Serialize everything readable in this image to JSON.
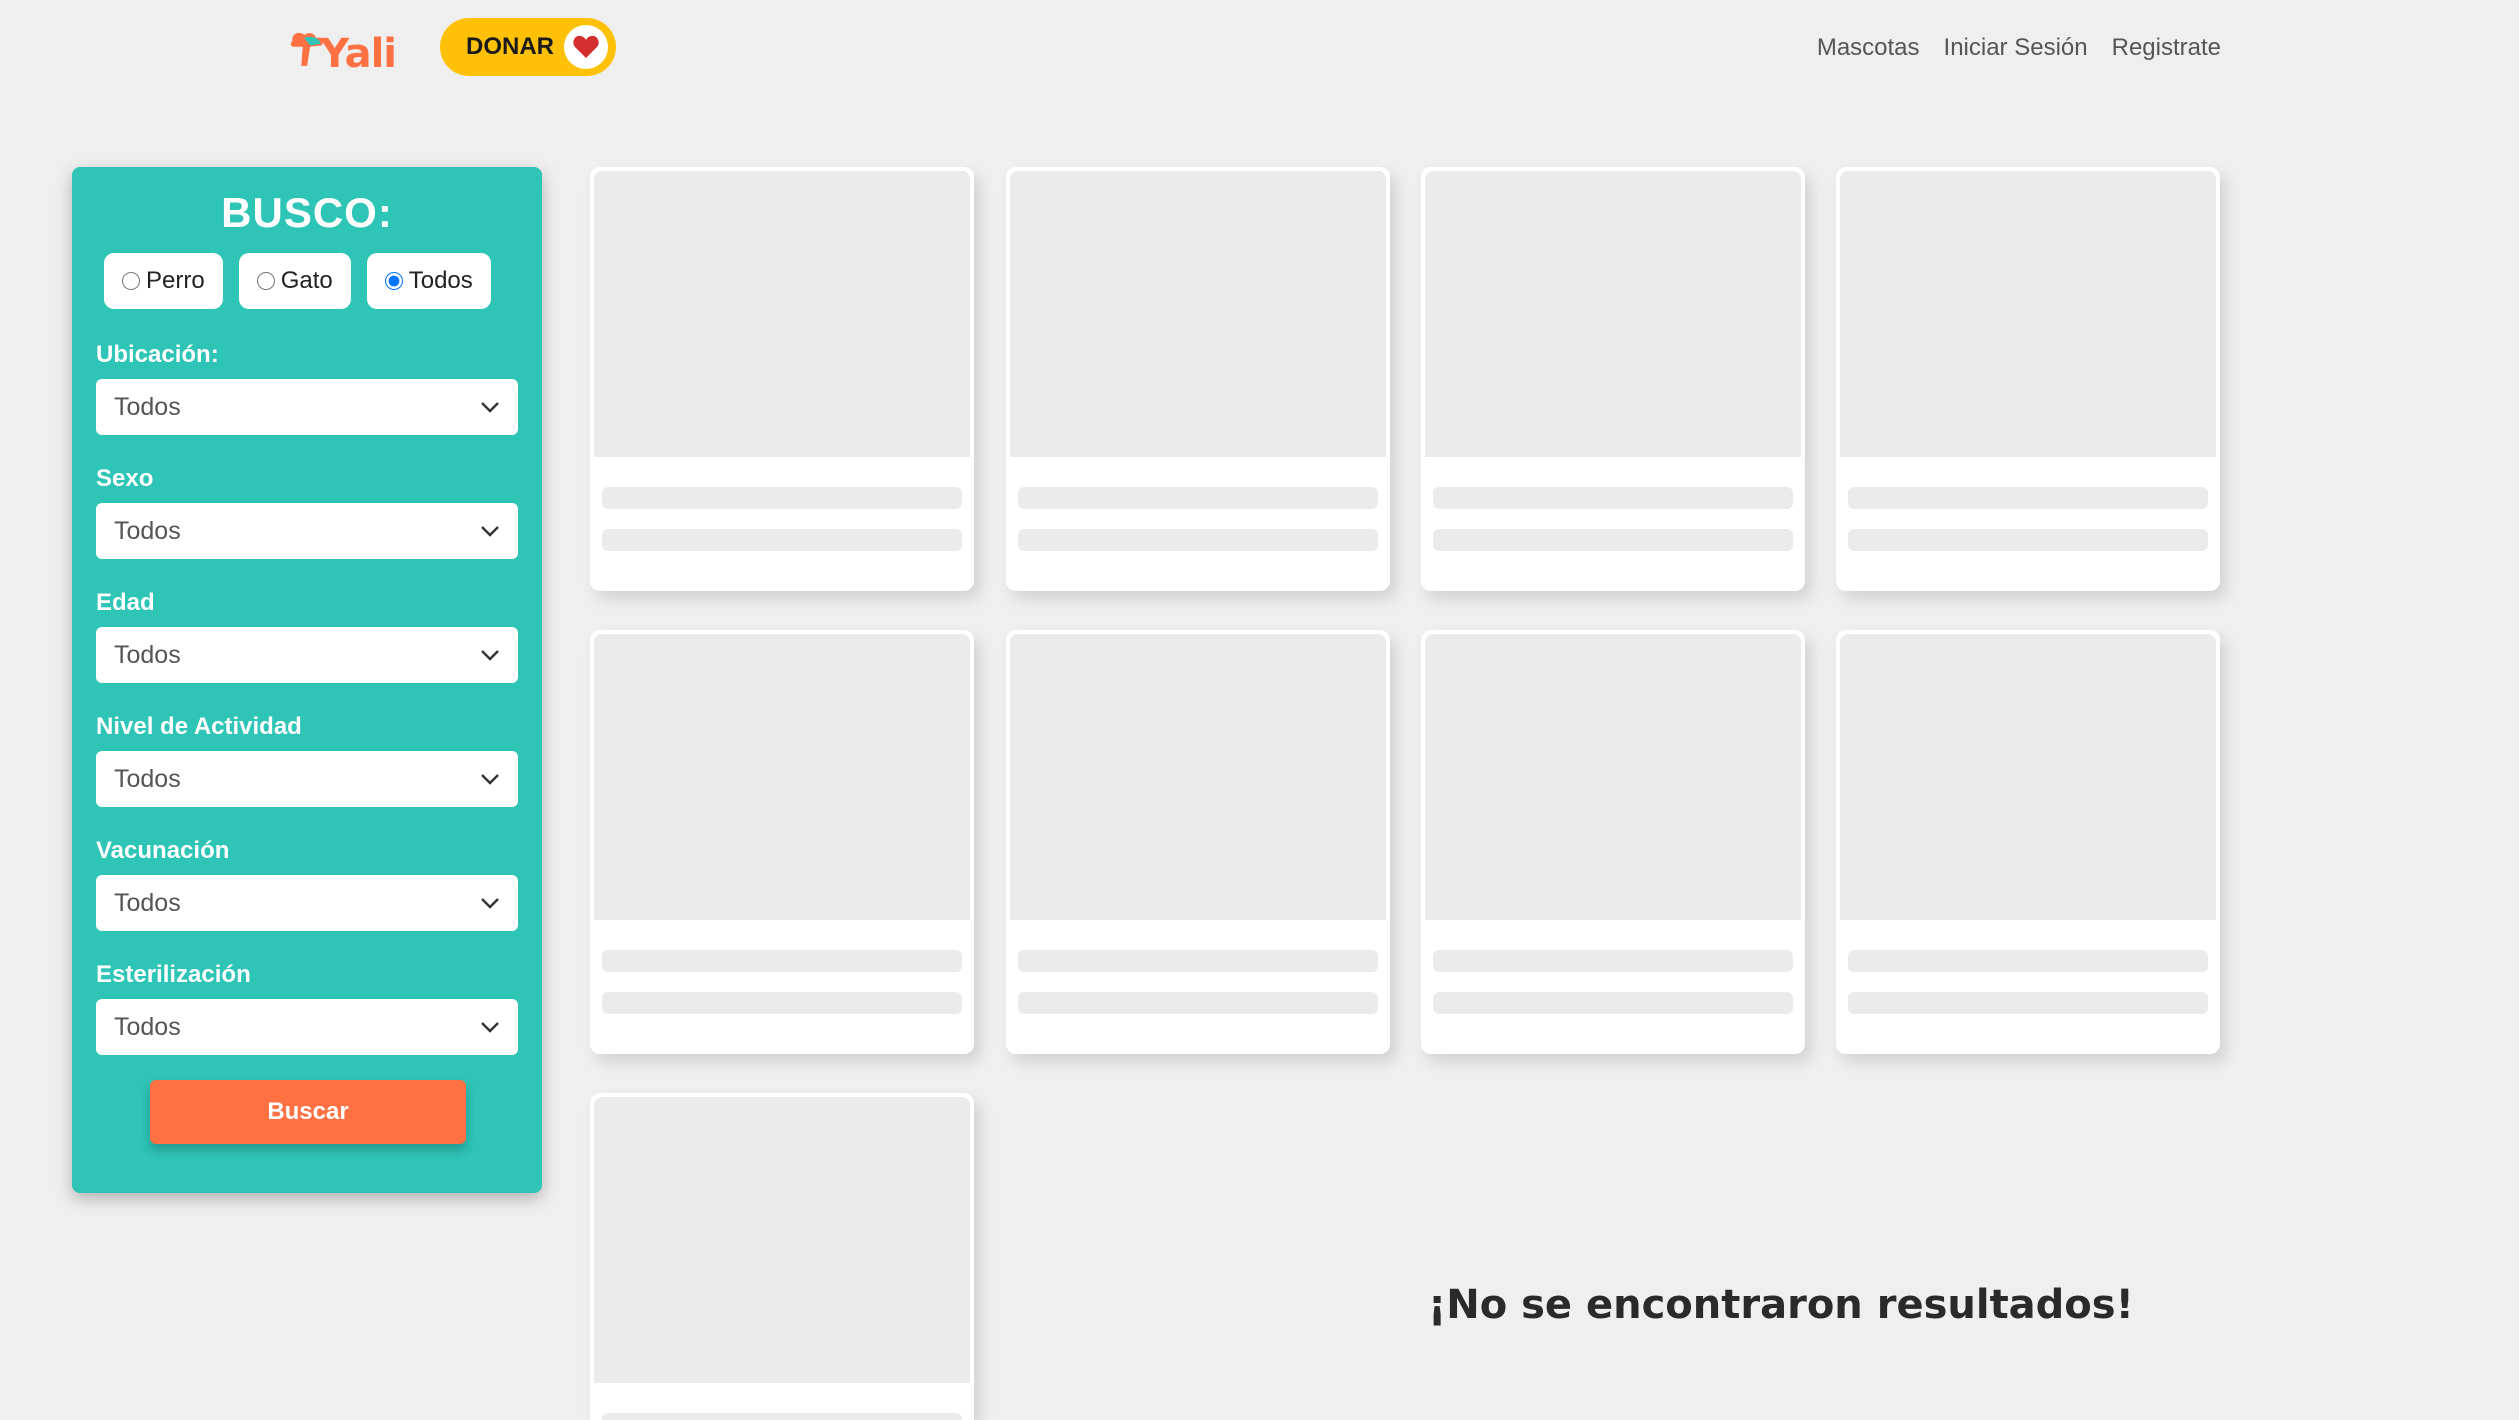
{
  "header": {
    "logo_text": "Yali",
    "donate_label": "DONAR",
    "nav": [
      "Mascotas",
      "Iniciar Sesión",
      "Registrate"
    ]
  },
  "filters": {
    "title": "BUSCO:",
    "species": [
      {
        "label": "Perro",
        "checked": false
      },
      {
        "label": "Gato",
        "checked": false
      },
      {
        "label": "Todos",
        "checked": true
      }
    ],
    "fields": [
      {
        "label": "Ubicación:",
        "value": "Todos"
      },
      {
        "label": "Sexo",
        "value": "Todos"
      },
      {
        "label": "Edad",
        "value": "Todos"
      },
      {
        "label": "Nivel de Actividad",
        "value": "Todos"
      },
      {
        "label": "Vacunación",
        "value": "Todos"
      },
      {
        "label": "Esterilización",
        "value": "Todos"
      }
    ],
    "search_label": "Buscar"
  },
  "results": {
    "placeholder_cards": 9,
    "empty_message": "¡No se encontraron resultados!"
  },
  "colors": {
    "panel": "#2ec4b6",
    "accent": "#ff7043",
    "donate": "#ffc107",
    "heart": "#d32f2f"
  }
}
